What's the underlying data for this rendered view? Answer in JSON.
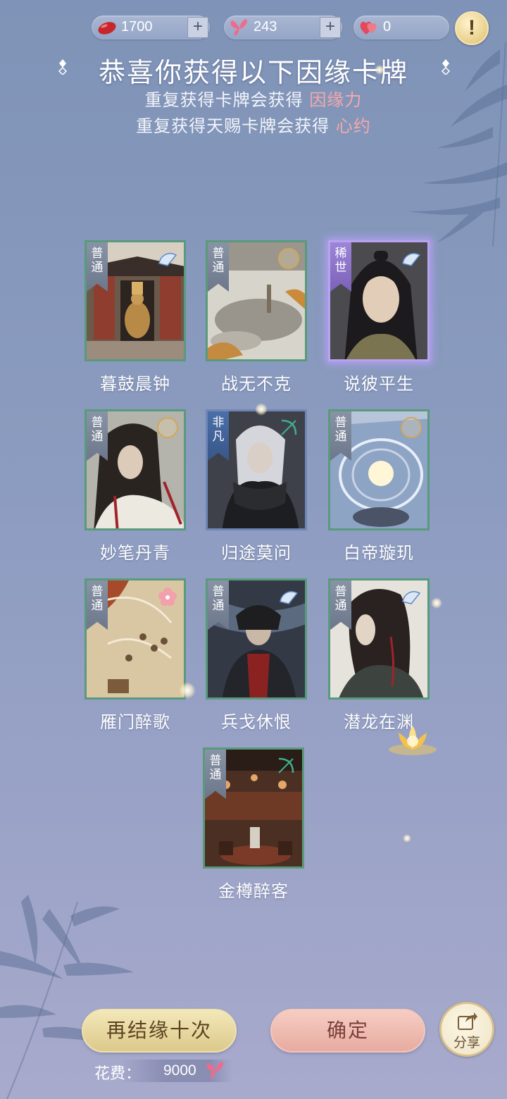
{
  "currency": {
    "jade": {
      "value": "1700",
      "icon": "red-jade-icon"
    },
    "butterfly": {
      "value": "243",
      "icon": "butterfly-icon"
    },
    "hearts": {
      "value": "0",
      "icon": "heart-icon"
    },
    "plus": "+",
    "info": "!"
  },
  "title": "恭喜你获得以下因缘卡牌",
  "notes": [
    {
      "prefix": "重复获得卡牌会获得",
      "highlight": "因缘力"
    },
    {
      "prefix": "重复获得天赐卡牌会获得",
      "highlight": "心约"
    }
  ],
  "cards": [
    {
      "rarity": "普通",
      "name": "暮鼓晨钟"
    },
    {
      "rarity": "普通",
      "name": "战无不克"
    },
    {
      "rarity": "稀世",
      "name": "说彼平生"
    },
    {
      "rarity": "普通",
      "name": "妙笔丹青"
    },
    {
      "rarity": "非凡",
      "name": "归途莫问"
    },
    {
      "rarity": "普通",
      "name": "白帝璇玑"
    },
    {
      "rarity": "普通",
      "name": "雁门醉歌"
    },
    {
      "rarity": "普通",
      "name": "兵戈休恨"
    },
    {
      "rarity": "普通",
      "name": "潜龙在渊"
    },
    {
      "rarity": "普通",
      "name": "金樽醉客"
    }
  ],
  "buttons": {
    "again": "再结缘十次",
    "confirm": "确定",
    "share": "分享"
  },
  "cost": {
    "label": "花费：",
    "value": "9000"
  },
  "colors": {
    "common_border": "#5a9a7c",
    "rare_glow": "#b8a3ee",
    "highlight": "#f5a8ad",
    "gold_button": "#e8d79e",
    "pink_button": "#f0bcb1"
  }
}
